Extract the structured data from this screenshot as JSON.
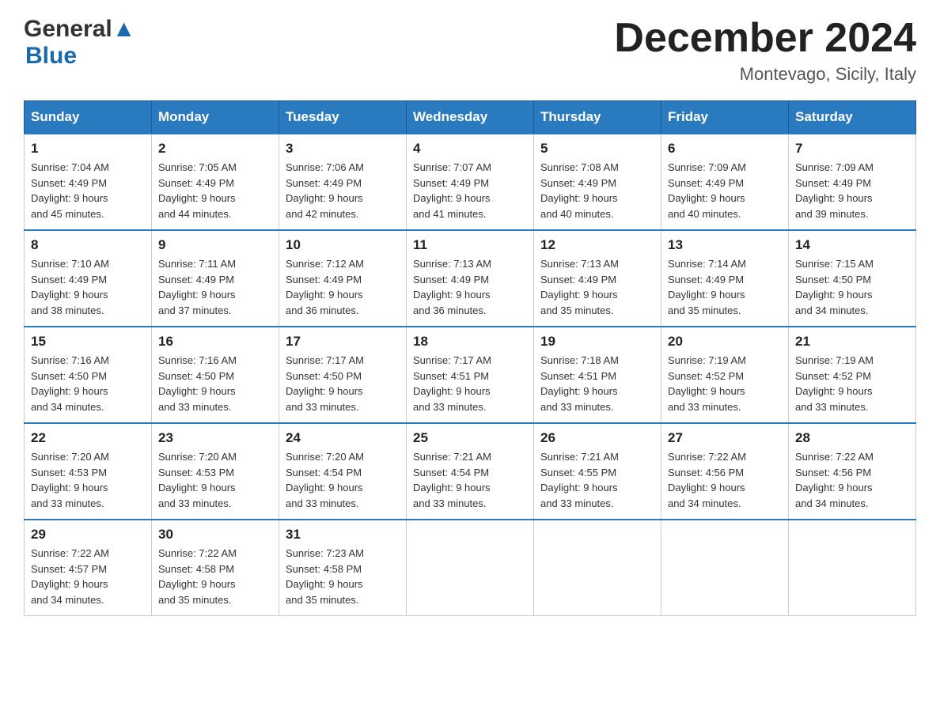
{
  "header": {
    "logo_general": "General",
    "logo_blue": "Blue",
    "month_title": "December 2024",
    "location": "Montevago, Sicily, Italy"
  },
  "calendar": {
    "days_of_week": [
      "Sunday",
      "Monday",
      "Tuesday",
      "Wednesday",
      "Thursday",
      "Friday",
      "Saturday"
    ],
    "weeks": [
      [
        {
          "day": "1",
          "sunrise": "7:04 AM",
          "sunset": "4:49 PM",
          "daylight": "9 hours and 45 minutes."
        },
        {
          "day": "2",
          "sunrise": "7:05 AM",
          "sunset": "4:49 PM",
          "daylight": "9 hours and 44 minutes."
        },
        {
          "day": "3",
          "sunrise": "7:06 AM",
          "sunset": "4:49 PM",
          "daylight": "9 hours and 42 minutes."
        },
        {
          "day": "4",
          "sunrise": "7:07 AM",
          "sunset": "4:49 PM",
          "daylight": "9 hours and 41 minutes."
        },
        {
          "day": "5",
          "sunrise": "7:08 AM",
          "sunset": "4:49 PM",
          "daylight": "9 hours and 40 minutes."
        },
        {
          "day": "6",
          "sunrise": "7:09 AM",
          "sunset": "4:49 PM",
          "daylight": "9 hours and 40 minutes."
        },
        {
          "day": "7",
          "sunrise": "7:09 AM",
          "sunset": "4:49 PM",
          "daylight": "9 hours and 39 minutes."
        }
      ],
      [
        {
          "day": "8",
          "sunrise": "7:10 AM",
          "sunset": "4:49 PM",
          "daylight": "9 hours and 38 minutes."
        },
        {
          "day": "9",
          "sunrise": "7:11 AM",
          "sunset": "4:49 PM",
          "daylight": "9 hours and 37 minutes."
        },
        {
          "day": "10",
          "sunrise": "7:12 AM",
          "sunset": "4:49 PM",
          "daylight": "9 hours and 36 minutes."
        },
        {
          "day": "11",
          "sunrise": "7:13 AM",
          "sunset": "4:49 PM",
          "daylight": "9 hours and 36 minutes."
        },
        {
          "day": "12",
          "sunrise": "7:13 AM",
          "sunset": "4:49 PM",
          "daylight": "9 hours and 35 minutes."
        },
        {
          "day": "13",
          "sunrise": "7:14 AM",
          "sunset": "4:49 PM",
          "daylight": "9 hours and 35 minutes."
        },
        {
          "day": "14",
          "sunrise": "7:15 AM",
          "sunset": "4:50 PM",
          "daylight": "9 hours and 34 minutes."
        }
      ],
      [
        {
          "day": "15",
          "sunrise": "7:16 AM",
          "sunset": "4:50 PM",
          "daylight": "9 hours and 34 minutes."
        },
        {
          "day": "16",
          "sunrise": "7:16 AM",
          "sunset": "4:50 PM",
          "daylight": "9 hours and 33 minutes."
        },
        {
          "day": "17",
          "sunrise": "7:17 AM",
          "sunset": "4:50 PM",
          "daylight": "9 hours and 33 minutes."
        },
        {
          "day": "18",
          "sunrise": "7:17 AM",
          "sunset": "4:51 PM",
          "daylight": "9 hours and 33 minutes."
        },
        {
          "day": "19",
          "sunrise": "7:18 AM",
          "sunset": "4:51 PM",
          "daylight": "9 hours and 33 minutes."
        },
        {
          "day": "20",
          "sunrise": "7:19 AM",
          "sunset": "4:52 PM",
          "daylight": "9 hours and 33 minutes."
        },
        {
          "day": "21",
          "sunrise": "7:19 AM",
          "sunset": "4:52 PM",
          "daylight": "9 hours and 33 minutes."
        }
      ],
      [
        {
          "day": "22",
          "sunrise": "7:20 AM",
          "sunset": "4:53 PM",
          "daylight": "9 hours and 33 minutes."
        },
        {
          "day": "23",
          "sunrise": "7:20 AM",
          "sunset": "4:53 PM",
          "daylight": "9 hours and 33 minutes."
        },
        {
          "day": "24",
          "sunrise": "7:20 AM",
          "sunset": "4:54 PM",
          "daylight": "9 hours and 33 minutes."
        },
        {
          "day": "25",
          "sunrise": "7:21 AM",
          "sunset": "4:54 PM",
          "daylight": "9 hours and 33 minutes."
        },
        {
          "day": "26",
          "sunrise": "7:21 AM",
          "sunset": "4:55 PM",
          "daylight": "9 hours and 33 minutes."
        },
        {
          "day": "27",
          "sunrise": "7:22 AM",
          "sunset": "4:56 PM",
          "daylight": "9 hours and 34 minutes."
        },
        {
          "day": "28",
          "sunrise": "7:22 AM",
          "sunset": "4:56 PM",
          "daylight": "9 hours and 34 minutes."
        }
      ],
      [
        {
          "day": "29",
          "sunrise": "7:22 AM",
          "sunset": "4:57 PM",
          "daylight": "9 hours and 34 minutes."
        },
        {
          "day": "30",
          "sunrise": "7:22 AM",
          "sunset": "4:58 PM",
          "daylight": "9 hours and 35 minutes."
        },
        {
          "day": "31",
          "sunrise": "7:23 AM",
          "sunset": "4:58 PM",
          "daylight": "9 hours and 35 minutes."
        },
        null,
        null,
        null,
        null
      ]
    ],
    "labels": {
      "sunrise": "Sunrise: ",
      "sunset": "Sunset: ",
      "daylight": "Daylight: "
    }
  }
}
